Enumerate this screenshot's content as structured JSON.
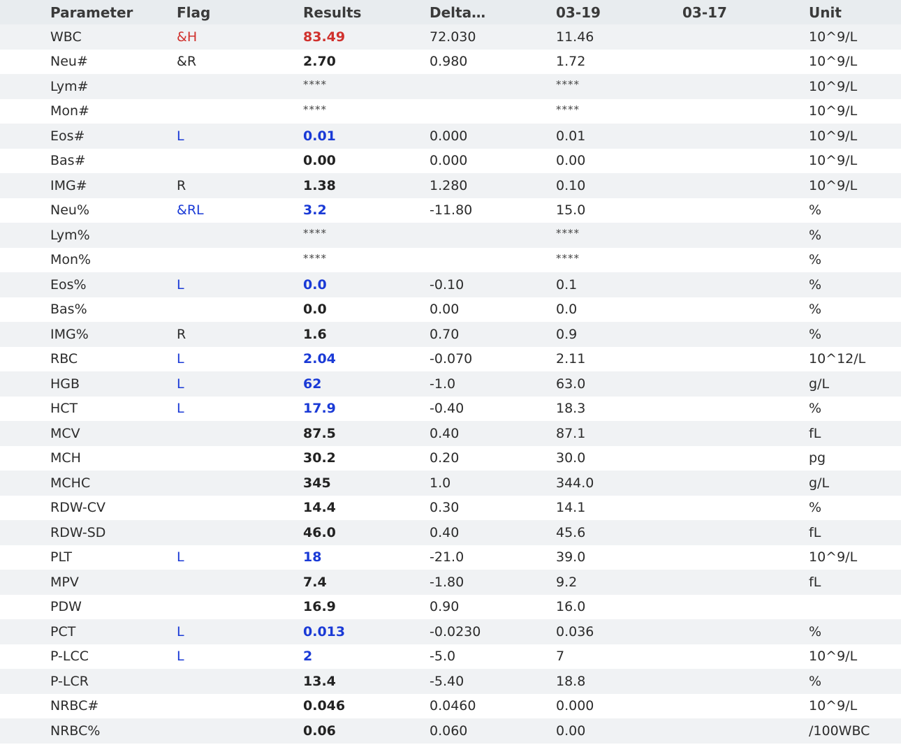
{
  "table": {
    "headers": [
      "Parameter",
      "Flag",
      "Results",
      "Delta…",
      "03-19",
      "03-17",
      "Unit"
    ],
    "rows": [
      {
        "param": "WBC",
        "flag": "&H",
        "status": "high",
        "result": "83.49",
        "delta": "72.030",
        "prev1": "11.46",
        "prev2": "",
        "unit": "10^9/L"
      },
      {
        "param": "Neu#",
        "flag": "&R",
        "status": "none",
        "result": "2.70",
        "delta": "0.980",
        "prev1": "1.72",
        "prev2": "",
        "unit": "10^9/L"
      },
      {
        "param": "Lym#",
        "flag": "",
        "status": "none",
        "result": "****",
        "delta": "",
        "prev1": "****",
        "prev2": "",
        "unit": "10^9/L"
      },
      {
        "param": "Mon#",
        "flag": "",
        "status": "none",
        "result": "****",
        "delta": "",
        "prev1": "****",
        "prev2": "",
        "unit": "10^9/L"
      },
      {
        "param": "Eos#",
        "flag": "L",
        "status": "low",
        "result": "0.01",
        "delta": "0.000",
        "prev1": "0.01",
        "prev2": "",
        "unit": "10^9/L"
      },
      {
        "param": "Bas#",
        "flag": "",
        "status": "none",
        "result": "0.00",
        "delta": "0.000",
        "prev1": "0.00",
        "prev2": "",
        "unit": "10^9/L"
      },
      {
        "param": "IMG#",
        "flag": "R",
        "status": "none",
        "result": "1.38",
        "delta": "1.280",
        "prev1": "0.10",
        "prev2": "",
        "unit": "10^9/L"
      },
      {
        "param": "Neu%",
        "flag": "&RL",
        "status": "low",
        "result": "3.2",
        "delta": "-11.80",
        "prev1": "15.0",
        "prev2": "",
        "unit": "%"
      },
      {
        "param": "Lym%",
        "flag": "",
        "status": "none",
        "result": "****",
        "delta": "",
        "prev1": "****",
        "prev2": "",
        "unit": "%"
      },
      {
        "param": "Mon%",
        "flag": "",
        "status": "none",
        "result": "****",
        "delta": "",
        "prev1": "****",
        "prev2": "",
        "unit": "%"
      },
      {
        "param": "Eos%",
        "flag": "L",
        "status": "low",
        "result": "0.0",
        "delta": "-0.10",
        "prev1": "0.1",
        "prev2": "",
        "unit": "%"
      },
      {
        "param": "Bas%",
        "flag": "",
        "status": "none",
        "result": "0.0",
        "delta": "0.00",
        "prev1": "0.0",
        "prev2": "",
        "unit": "%"
      },
      {
        "param": "IMG%",
        "flag": "R",
        "status": "none",
        "result": "1.6",
        "delta": "0.70",
        "prev1": "0.9",
        "prev2": "",
        "unit": "%"
      },
      {
        "param": "RBC",
        "flag": "L",
        "status": "low",
        "result": "2.04",
        "delta": "-0.070",
        "prev1": "2.11",
        "prev2": "",
        "unit": "10^12/L"
      },
      {
        "param": "HGB",
        "flag": "L",
        "status": "low",
        "result": "62",
        "delta": "-1.0",
        "prev1": "63.0",
        "prev2": "",
        "unit": "g/L"
      },
      {
        "param": "HCT",
        "flag": "L",
        "status": "low",
        "result": "17.9",
        "delta": "-0.40",
        "prev1": "18.3",
        "prev2": "",
        "unit": "%"
      },
      {
        "param": "MCV",
        "flag": "",
        "status": "none",
        "result": "87.5",
        "delta": "0.40",
        "prev1": "87.1",
        "prev2": "",
        "unit": "fL"
      },
      {
        "param": "MCH",
        "flag": "",
        "status": "none",
        "result": "30.2",
        "delta": "0.20",
        "prev1": "30.0",
        "prev2": "",
        "unit": "pg"
      },
      {
        "param": "MCHC",
        "flag": "",
        "status": "none",
        "result": "345",
        "delta": "1.0",
        "prev1": "344.0",
        "prev2": "",
        "unit": "g/L"
      },
      {
        "param": "RDW-CV",
        "flag": "",
        "status": "none",
        "result": "14.4",
        "delta": "0.30",
        "prev1": "14.1",
        "prev2": "",
        "unit": "%"
      },
      {
        "param": "RDW-SD",
        "flag": "",
        "status": "none",
        "result": "46.0",
        "delta": "0.40",
        "prev1": "45.6",
        "prev2": "",
        "unit": "fL"
      },
      {
        "param": "PLT",
        "flag": "L",
        "status": "low",
        "result": "18",
        "delta": "-21.0",
        "prev1": "39.0",
        "prev2": "",
        "unit": "10^9/L"
      },
      {
        "param": "MPV",
        "flag": "",
        "status": "none",
        "result": "7.4",
        "delta": "-1.80",
        "prev1": "9.2",
        "prev2": "",
        "unit": "fL"
      },
      {
        "param": "PDW",
        "flag": "",
        "status": "none",
        "result": "16.9",
        "delta": "0.90",
        "prev1": "16.0",
        "prev2": "",
        "unit": ""
      },
      {
        "param": "PCT",
        "flag": "L",
        "status": "low",
        "result": "0.013",
        "delta": "-0.0230",
        "prev1": "0.036",
        "prev2": "",
        "unit": "%"
      },
      {
        "param": "P-LCC",
        "flag": "L",
        "status": "low",
        "result": "2",
        "delta": "-5.0",
        "prev1": "7",
        "prev2": "",
        "unit": "10^9/L"
      },
      {
        "param": "P-LCR",
        "flag": "",
        "status": "none",
        "result": "13.4",
        "delta": "-5.40",
        "prev1": "18.8",
        "prev2": "",
        "unit": "%"
      },
      {
        "param": "NRBC#",
        "flag": "",
        "status": "none",
        "result": "0.046",
        "delta": "0.0460",
        "prev1": "0.000",
        "prev2": "",
        "unit": "10^9/L"
      },
      {
        "param": "NRBC%",
        "flag": "",
        "status": "none",
        "result": "0.06",
        "delta": "0.060",
        "prev1": "0.00",
        "prev2": "",
        "unit": "/100WBC"
      }
    ]
  },
  "colors": {
    "header_bg": "#e8ecef",
    "stripe_bg": "#f0f2f4",
    "high": "#d0312d",
    "low": "#1a3ad6"
  }
}
